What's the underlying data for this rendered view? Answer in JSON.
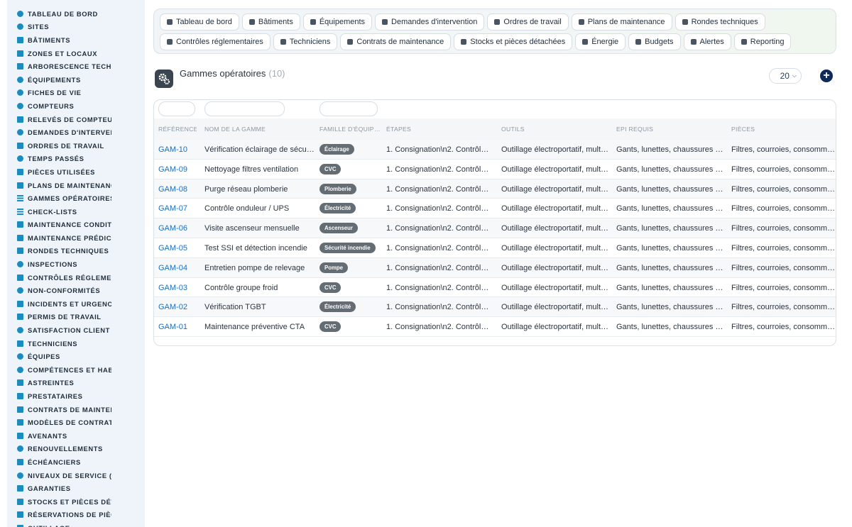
{
  "sidebar": {
    "items": [
      {
        "label": "Tableau de bord",
        "icon": "dashboard-icon",
        "shape": "c"
      },
      {
        "label": "Sites",
        "icon": "location-pin-icon",
        "shape": "c"
      },
      {
        "label": "Bâtiments",
        "icon": "building-icon",
        "shape": "s"
      },
      {
        "label": "Zones et locaux",
        "icon": "door-icon",
        "shape": "s"
      },
      {
        "label": "Arborescence techni",
        "icon": "sitemap-icon",
        "shape": "s"
      },
      {
        "label": "Équipements",
        "icon": "gears-icon",
        "shape": "c"
      },
      {
        "label": "Fiches de vie",
        "icon": "history-icon",
        "shape": "c"
      },
      {
        "label": "Compteurs",
        "icon": "gauge-icon",
        "shape": "c"
      },
      {
        "label": "Relevés de compteurs",
        "icon": "clipboard-icon",
        "shape": "s"
      },
      {
        "label": "Demandes d'intervention",
        "icon": "question-circle-icon",
        "shape": "c"
      },
      {
        "label": "Ordres de travail",
        "icon": "clipboard-check-icon",
        "shape": "s"
      },
      {
        "label": "Temps passés",
        "icon": "clock-icon",
        "shape": "c"
      },
      {
        "label": "Pièces utilisées",
        "icon": "cubes-icon",
        "shape": "s"
      },
      {
        "label": "Plans de maintenance",
        "icon": "calendar-icon",
        "shape": "s"
      },
      {
        "label": "Gammes opératoires",
        "icon": "list-icon",
        "shape": "l"
      },
      {
        "label": "Check-lists",
        "icon": "checklist-icon",
        "shape": "l"
      },
      {
        "label": "Maintenance conditionnelle",
        "icon": "thermometer-icon",
        "shape": "s"
      },
      {
        "label": "Maintenance prédictive",
        "icon": "chart-line-icon",
        "shape": "s"
      },
      {
        "label": "Rondes techniques",
        "icon": "route-icon",
        "shape": "s"
      },
      {
        "label": "Inspections",
        "icon": "search-icon",
        "shape": "c"
      },
      {
        "label": "Contrôles réglementaires",
        "icon": "certificate-icon",
        "shape": "s"
      },
      {
        "label": "Non-conformités",
        "icon": "exclamation-circle-icon",
        "shape": "c"
      },
      {
        "label": "Incidents et urgences",
        "icon": "warning-icon",
        "shape": "s"
      },
      {
        "label": "Permis de travail",
        "icon": "file-signature-icon",
        "shape": "s"
      },
      {
        "label": "Satisfaction client",
        "icon": "smile-icon",
        "shape": "c"
      },
      {
        "label": "Techniciens",
        "icon": "hard-hat-icon",
        "shape": "s"
      },
      {
        "label": "Équipes",
        "icon": "users-icon",
        "shape": "c"
      },
      {
        "label": "Compétences et habilitations",
        "icon": "award-icon",
        "shape": "c"
      },
      {
        "label": "Astreintes",
        "icon": "phone-icon",
        "shape": "s"
      },
      {
        "label": "Prestataires",
        "icon": "handshake-icon",
        "shape": "s"
      },
      {
        "label": "Contrats de maintenance",
        "icon": "file-contract-icon",
        "shape": "s"
      },
      {
        "label": "Modèles de contrats",
        "icon": "file-icon",
        "shape": "s"
      },
      {
        "label": "Avenants",
        "icon": "file-edit-icon",
        "shape": "s"
      },
      {
        "label": "Renouvellements",
        "icon": "sync-icon",
        "shape": "c"
      },
      {
        "label": "Échéanciers",
        "icon": "calendar-alt-icon",
        "shape": "s"
      },
      {
        "label": "Niveaux de service (SLA)",
        "icon": "tachometer-icon",
        "shape": "c"
      },
      {
        "label": "Garanties",
        "icon": "shield-icon",
        "shape": "s"
      },
      {
        "label": "Stocks et pièces détachées",
        "icon": "boxes-icon",
        "shape": "s"
      },
      {
        "label": "Réservations de pièces",
        "icon": "bookmark-icon",
        "shape": "s"
      },
      {
        "label": "Outillage",
        "icon": "tools-icon",
        "shape": "s"
      }
    ]
  },
  "topnav": {
    "rows": [
      [
        {
          "label": "Tableau de bord",
          "icon": "dashboard-icon"
        },
        {
          "label": "Bâtiments",
          "icon": "building-icon"
        },
        {
          "label": "Équipements",
          "icon": "gears-icon"
        },
        {
          "label": "Demandes d'intervention",
          "icon": "question-circle-icon"
        },
        {
          "label": "Ordres de travail",
          "icon": "clipboard-check-icon"
        },
        {
          "label": "Plans de maintenance",
          "icon": "calendar-icon"
        },
        {
          "label": "Rondes techniques",
          "icon": "route-icon"
        }
      ],
      [
        {
          "label": "Contrôles réglementaires",
          "icon": "certificate-icon"
        },
        {
          "label": "Techniciens",
          "icon": "hard-hat-icon"
        },
        {
          "label": "Contrats de maintenance",
          "icon": "file-contract-icon"
        },
        {
          "label": "Stocks et pièces détachées",
          "icon": "boxes-icon"
        },
        {
          "label": "Énergie",
          "icon": "bolt-icon"
        },
        {
          "label": "Budgets",
          "icon": "money-icon"
        },
        {
          "label": "Alertes",
          "icon": "bell-icon"
        },
        {
          "label": "Reporting",
          "icon": "chart-pie-icon"
        }
      ]
    ]
  },
  "page": {
    "title": "Gammes opératoires",
    "count": "(10)",
    "per_page": "20",
    "add_label": "+"
  },
  "table": {
    "columns": [
      "Référence",
      "Nom de la gamme",
      "Famille d'équip…",
      "Étapes",
      "Outils",
      "EPI requis",
      "Pièces"
    ],
    "rows": [
      {
        "ref": "GAM-10",
        "name": "Vérification éclairage de sécu…",
        "family": "Éclairage",
        "steps": "1. Consignation\\n2. Contrôle …",
        "tools": "Outillage électroportatif, multi…",
        "epi": "Gants, lunettes, chaussures d…",
        "parts": "Filtres, courroies, consomma…"
      },
      {
        "ref": "GAM-09",
        "name": "Nettoyage filtres ventilation",
        "family": "CVC",
        "steps": "1. Consignation\\n2. Contrôle …",
        "tools": "Outillage électroportatif, multi…",
        "epi": "Gants, lunettes, chaussures d…",
        "parts": "Filtres, courroies, consomma…"
      },
      {
        "ref": "GAM-08",
        "name": "Purge réseau plomberie",
        "family": "Plomberie",
        "steps": "1. Consignation\\n2. Contrôle …",
        "tools": "Outillage électroportatif, multi…",
        "epi": "Gants, lunettes, chaussures d…",
        "parts": "Filtres, courroies, consomma…"
      },
      {
        "ref": "GAM-07",
        "name": "Contrôle onduleur / UPS",
        "family": "Électricité",
        "steps": "1. Consignation\\n2. Contrôle …",
        "tools": "Outillage électroportatif, multi…",
        "epi": "Gants, lunettes, chaussures d…",
        "parts": "Filtres, courroies, consomma…"
      },
      {
        "ref": "GAM-06",
        "name": "Visite ascenseur mensuelle",
        "family": "Ascenseur",
        "steps": "1. Consignation\\n2. Contrôle …",
        "tools": "Outillage électroportatif, multi…",
        "epi": "Gants, lunettes, chaussures d…",
        "parts": "Filtres, courroies, consomma…"
      },
      {
        "ref": "GAM-05",
        "name": "Test SSI et détection incendie",
        "family": "Sécurité incendie",
        "steps": "1. Consignation\\n2. Contrôle …",
        "tools": "Outillage électroportatif, multi…",
        "epi": "Gants, lunettes, chaussures d…",
        "parts": "Filtres, courroies, consomma…"
      },
      {
        "ref": "GAM-04",
        "name": "Entretien pompe de relevage",
        "family": "Pompe",
        "steps": "1. Consignation\\n2. Contrôle …",
        "tools": "Outillage électroportatif, multi…",
        "epi": "Gants, lunettes, chaussures d…",
        "parts": "Filtres, courroies, consomma…"
      },
      {
        "ref": "GAM-03",
        "name": "Contrôle groupe froid",
        "family": "CVC",
        "steps": "1. Consignation\\n2. Contrôle …",
        "tools": "Outillage électroportatif, multi…",
        "epi": "Gants, lunettes, chaussures d…",
        "parts": "Filtres, courroies, consomma…"
      },
      {
        "ref": "GAM-02",
        "name": "Vérification TGBT",
        "family": "Électricité",
        "steps": "1. Consignation\\n2. Contrôle …",
        "tools": "Outillage électroportatif, multi…",
        "epi": "Gants, lunettes, chaussures d…",
        "parts": "Filtres, courroies, consomma…"
      },
      {
        "ref": "GAM-01",
        "name": "Maintenance préventive CTA",
        "family": "CVC",
        "steps": "1. Consignation\\n2. Contrôle …",
        "tools": "Outillage électroportatif, multi…",
        "epi": "Gants, lunettes, chaussures d…",
        "parts": "Filtres, courroies, consomma…"
      }
    ]
  },
  "colors": {
    "accent": "#1a8cbf",
    "link": "#1a6fbf",
    "badge": "#646c74",
    "add_button": "#0f2a5a"
  }
}
